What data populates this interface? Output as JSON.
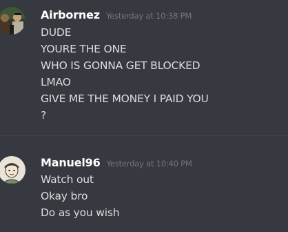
{
  "messages": [
    {
      "username": "Airbornez",
      "timestamp": "Yesterday at 10:38 PM",
      "lines": [
        "DUDE",
        "YOURE THE ONE",
        "WHO IS GONNA GET BLOCKED",
        "LMAO",
        "GIVE ME THE MONEY I PAID YOU",
        "?"
      ]
    },
    {
      "username": "Manuel96",
      "timestamp": "Yesterday at 10:40 PM",
      "lines": [
        "Watch out",
        "Okay bro",
        "Do as you wish"
      ]
    }
  ],
  "colors": {
    "background": "#36393f",
    "username": "#ffffff",
    "timestamp": "#72767d",
    "message_text": "#dcddde"
  }
}
